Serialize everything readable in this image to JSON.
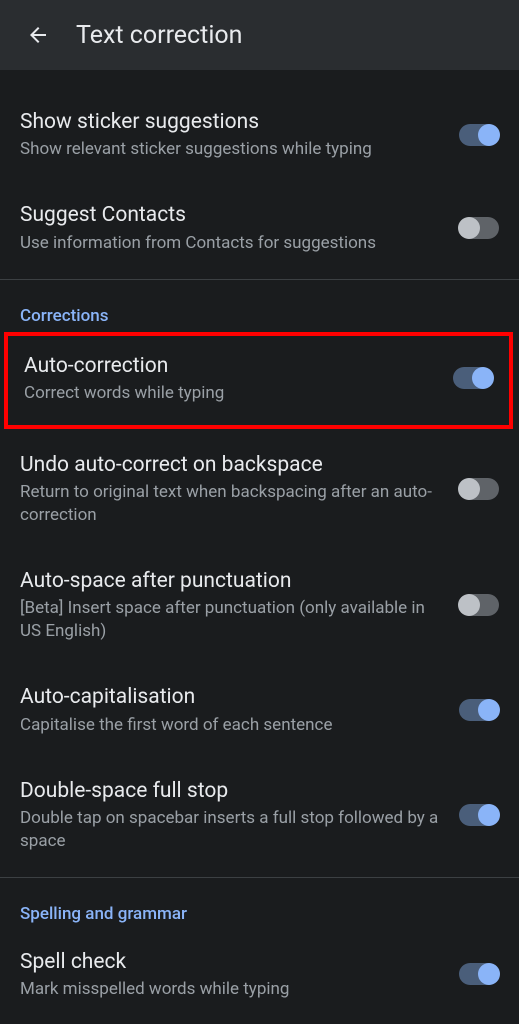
{
  "header": {
    "title": "Text correction"
  },
  "settings": [
    {
      "title": "Show sticker suggestions",
      "subtitle": "Show relevant sticker suggestions while typing",
      "enabled": true
    },
    {
      "title": "Suggest Contacts",
      "subtitle": "Use information from Contacts for suggestions",
      "enabled": false
    }
  ],
  "sections": [
    {
      "header": "Corrections",
      "items": [
        {
          "title": "Auto-correction",
          "subtitle": "Correct words while typing",
          "enabled": true,
          "highlighted": true
        },
        {
          "title": "Undo auto-correct on backspace",
          "subtitle": "Return to original text when backspacing after an auto-correction",
          "enabled": false
        },
        {
          "title": "Auto-space after punctuation",
          "subtitle": "[Beta] Insert space after punctuation (only available in US English)",
          "enabled": false
        },
        {
          "title": "Auto-capitalisation",
          "subtitle": "Capitalise the first word of each sentence",
          "enabled": true
        },
        {
          "title": "Double-space full stop",
          "subtitle": "Double tap on spacebar inserts a full stop followed by a space",
          "enabled": true
        }
      ]
    },
    {
      "header": "Spelling and grammar",
      "items": [
        {
          "title": "Spell check",
          "subtitle": "Mark misspelled words while typing",
          "enabled": true
        }
      ]
    }
  ]
}
